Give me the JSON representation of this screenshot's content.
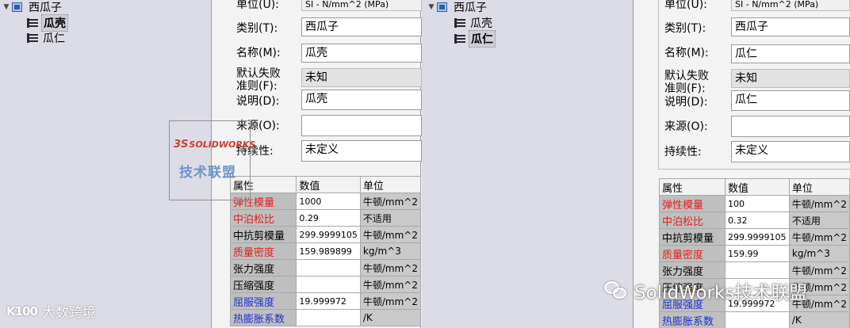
{
  "left_tree": {
    "root": "西瓜子",
    "items": [
      "瓜壳",
      "瓜仁"
    ],
    "selected_index": 0
  },
  "form_a": {
    "unit_label": "单位(U):",
    "unit_value": "SI - N/mm^2 (MPa)",
    "category_label": "类别(T):",
    "category_value": "西瓜子",
    "name_label": "名称(M):",
    "name_value": "瓜壳",
    "failure_label_line1": "默认失败",
    "failure_label_line2": "准则(F):",
    "failure_value": "未知",
    "desc_label": "说明(D):",
    "desc_value": "瓜壳",
    "source_label": "来源(O):",
    "source_value": "",
    "sustain_label": "持续性:",
    "sustain_value": "未定义"
  },
  "table_a": {
    "headers": [
      "属性",
      "数值",
      "单位"
    ],
    "rows": [
      {
        "name": "弹性模量",
        "value": "1000",
        "unit": "牛顿/mm^2",
        "color": "red"
      },
      {
        "name": "中泊松比",
        "value": "0.29",
        "unit": "不适用",
        "color": "red"
      },
      {
        "name": "中抗剪模量",
        "value": "299.9999105",
        "unit": "牛顿/mm^2",
        "color": "black"
      },
      {
        "name": "质量密度",
        "value": "159.989899",
        "unit": "kg/m^3",
        "color": "red"
      },
      {
        "name": "张力强度",
        "value": "",
        "unit": "牛顿/mm^2",
        "color": "black"
      },
      {
        "name": "压缩强度",
        "value": "",
        "unit": "牛顿/mm^2",
        "color": "black"
      },
      {
        "name": "屈服强度",
        "value": "19.999972",
        "unit": "牛顿/mm^2",
        "color": "blue"
      },
      {
        "name": "热膨胀系数",
        "value": "",
        "unit": "/K",
        "color": "blue"
      }
    ]
  },
  "mid_tree": {
    "root": "西瓜子",
    "items": [
      "瓜壳",
      "瓜仁"
    ],
    "selected_index": 1
  },
  "form_b": {
    "unit_label": "单位(U):",
    "unit_value": "SI - N/mm^2 (MPa)",
    "category_label": "类别(T):",
    "category_value": "西瓜子",
    "name_label": "名称(M):",
    "name_value": "瓜仁",
    "failure_label_line1": "默认失败",
    "failure_label_line2": "准则(F):",
    "failure_value": "未知",
    "desc_label": "说明(D):",
    "desc_value": "瓜仁",
    "source_label": "来源(O):",
    "source_value": "",
    "sustain_label": "持续性:",
    "sustain_value": "未定义"
  },
  "table_b": {
    "headers": [
      "属性",
      "数值",
      "单位"
    ],
    "rows": [
      {
        "name": "弹性模量",
        "value": "100",
        "unit": "牛顿/mm^2",
        "color": "red"
      },
      {
        "name": "中泊松比",
        "value": "0.32",
        "unit": "不适用",
        "color": "red"
      },
      {
        "name": "中抗剪模量",
        "value": "299.9999105",
        "unit": "牛顿/mm^2",
        "color": "black"
      },
      {
        "name": "质量密度",
        "value": "159.99",
        "unit": "kg/m^3",
        "color": "red"
      },
      {
        "name": "张力强度",
        "value": "",
        "unit": "牛顿/mm^2",
        "color": "black"
      },
      {
        "name": "压缩强度",
        "value": "",
        "unit": "牛顿/mm^2",
        "color": "black"
      },
      {
        "name": "屈服强度",
        "value": "19.999972",
        "unit": "牛顿/mm^2",
        "color": "blue"
      },
      {
        "name": "热膨胀系数",
        "value": "",
        "unit": "/K",
        "color": "blue"
      }
    ]
  },
  "watermarks": {
    "solidworks_logo": "SOLIDWORKS",
    "solidworks_sub": "技术联盟",
    "corner_text": "大数跨境",
    "corner_logo": "K100",
    "wechat_text": "SolidWorks技术联盟"
  }
}
